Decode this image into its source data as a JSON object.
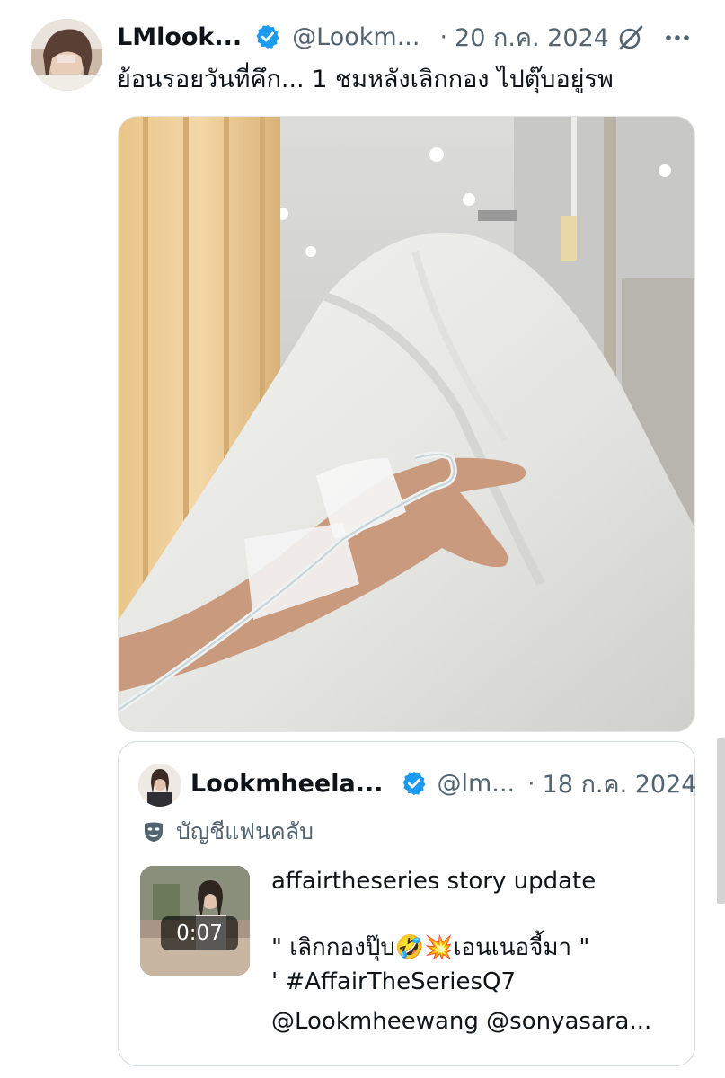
{
  "tweet": {
    "display_name": "LMlook...",
    "handle": "@Lookm...",
    "separator": "·",
    "date": "20 ก.ค. 2024",
    "text": "ย้อนรอยวันที่คึก... 1 ชมหลังเลิกกอง ไปตุ๊บอยู่รพ",
    "grok_icon": "grok-icon",
    "more_icon": "more-icon",
    "verified_color": "#1d9bf0"
  },
  "quoted_tweet": {
    "display_name": "Lookmheela...",
    "handle": "@lm...",
    "separator": "·",
    "date": "18 ก.ค. 2024",
    "account_label": "บัญชีแฟนคลับ",
    "video_duration": "0:07",
    "text_line1": "affairtheseries story update",
    "text_line2": "\" เลิกกองปุ๊บ🤣💥เอนเนอจี้มา \"",
    "text_line3": "' #AffairTheSeriesQ7",
    "text_line4": "@Lookmheewang @sonyasara..."
  },
  "colors": {
    "text_primary": "#0f1419",
    "text_secondary": "#536471",
    "verified": "#1d9bf0",
    "border": "#cfd9de"
  }
}
